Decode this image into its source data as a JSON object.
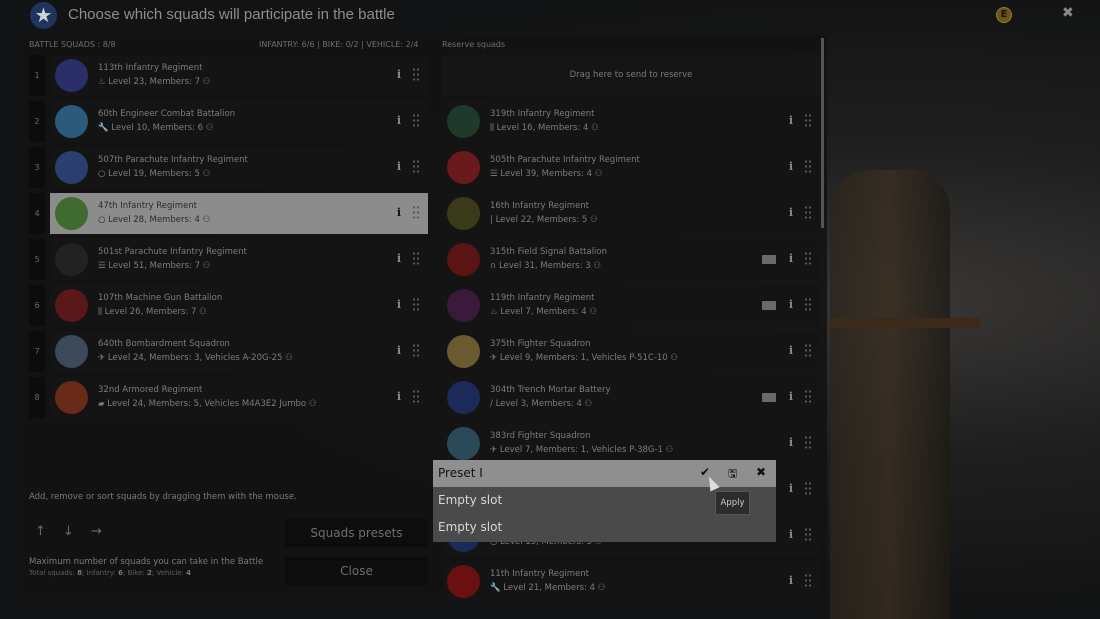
{
  "window": {
    "title": "Choose which squads will participate in the battle",
    "logo_icon": "star-icon",
    "currency_icon": "coin-icon",
    "close_icon": "close-icon"
  },
  "battle": {
    "header": "BATTLE SQUADS : 8/8",
    "counts": "INFANTRY: 6/6 | BIKE: 0/2 | VEHICLE: 2/4",
    "selected_index": 3,
    "squads": [
      {
        "num": "1",
        "name": "113th Infantry Regiment",
        "meta": "Level 23, Members: 7",
        "icon": "flame-icon",
        "color": "#2a2f6a"
      },
      {
        "num": "2",
        "name": "60th Engineer Combat Battalion",
        "meta": "Level 10, Members: 6",
        "icon": "wrench-icon",
        "color": "#2c5a7a"
      },
      {
        "num": "3",
        "name": "507th Parachute Infantry Regiment",
        "meta": "Level 19, Members: 5",
        "icon": "circle-icon",
        "color": "#2b3f6e"
      },
      {
        "num": "4",
        "name": "47th Infantry Regiment",
        "meta": "Level 28, Members: 4",
        "icon": "circle-icon",
        "color": "#3f6a30"
      },
      {
        "num": "5",
        "name": "501st Parachute Infantry Regiment",
        "meta": "Level 51, Members: 7",
        "icon": "list-icon",
        "color": "#222"
      },
      {
        "num": "6",
        "name": "107th Machine Gun Battalion",
        "meta": "Level 26, Members: 7",
        "icon": "ammo-icon",
        "color": "#5a1818"
      },
      {
        "num": "7",
        "name": "640th Bombardment Squadron",
        "meta": "Level 24, Members: 3, Vehicles A-20G-25",
        "icon": "plane-icon",
        "color": "#3a4a5a"
      },
      {
        "num": "8",
        "name": "32nd Armored Regiment",
        "meta": "Level 24, Members: 5, Vehicles M4A3E2 Jumbo",
        "icon": "tank-icon",
        "color": "#6a2a18"
      }
    ]
  },
  "reserve": {
    "header": "Reserve squads",
    "drop_text": "Drag here to send to reserve",
    "squads": [
      {
        "name": "319th Infantry Regiment",
        "meta": "Level 16, Members: 4",
        "icon": "ammo-icon",
        "color": "#1f3a2a",
        "book": false
      },
      {
        "name": "505th Parachute Infantry Regiment",
        "meta": "Level 39, Members: 4",
        "icon": "list-icon",
        "color": "#6a1a1a",
        "book": false
      },
      {
        "name": "16th Infantry Regiment",
        "meta": "Level 22, Members: 5",
        "icon": "bar-icon",
        "color": "#3a3a1a",
        "book": false
      },
      {
        "name": "315th Field Signal Battalion",
        "meta": "Level 31, Members: 3",
        "icon": "headset-icon",
        "color": "#5a1414",
        "book": true
      },
      {
        "name": "119th Infantry Regiment",
        "meta": "Level 7, Members: 4",
        "icon": "fire-icon",
        "color": "#3a1a3a",
        "book": true
      },
      {
        "name": "375th Fighter Squadron",
        "meta": "Level 9, Members: 1, Vehicles P-51C-10",
        "icon": "plane-icon",
        "color": "#6a5a30",
        "book": false
      },
      {
        "name": "304th Trench Mortar Battery",
        "meta": "Level 3, Members: 4",
        "icon": "mortar-icon",
        "color": "#1c2a5a",
        "book": true
      },
      {
        "name": "383rd Fighter Squadron",
        "meta": "Level 7, Members: 1, Vehicles P-38G-1",
        "icon": "plane-icon",
        "color": "#2a4a5a",
        "book": false
      },
      {
        "name": "",
        "meta": "",
        "icon": "",
        "color": "#222",
        "book": false
      },
      {
        "name": "",
        "meta": "Level 15, Members: 3",
        "icon": "circle-icon",
        "color": "#1c2a5a",
        "book": false
      },
      {
        "name": "11th Infantry Regiment",
        "meta": "Level 21, Members: 4",
        "icon": "wrench-icon",
        "color": "#6a1010",
        "book": false
      }
    ]
  },
  "footer": {
    "hint": "Add, remove or sort squads by dragging them with the mouse.",
    "arrows": [
      "↑",
      "↓",
      "→"
    ],
    "presets_button": "Squads presets",
    "close_button": "Close",
    "max_title": "Maximum number of squads you can take in the Battle",
    "max_detail": {
      "total_label": "Total squads:",
      "total": "8",
      "inf_label": "Infantry:",
      "inf": "6",
      "bike_label": "Bike:",
      "bike": "2",
      "veh_label": "Vehicle:",
      "veh": "4"
    }
  },
  "preset_popup": {
    "title": "Preset I",
    "slots": [
      "Empty slot",
      "Empty slot"
    ],
    "tooltip": "Apply",
    "icons": [
      "check-icon",
      "save-icon",
      "delete-icon"
    ]
  }
}
